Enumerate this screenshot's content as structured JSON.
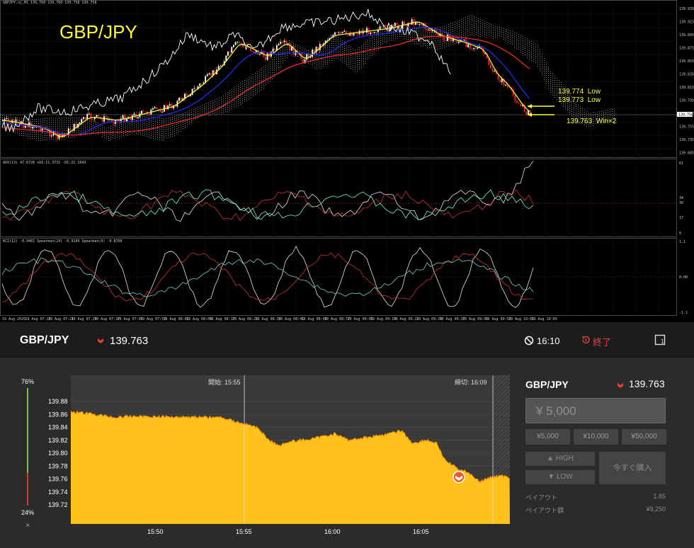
{
  "mt4": {
    "symbol_info": "GBPJPY.oj,M1  139.760 139.760 139.758 139.758",
    "title": "GBP/JPY",
    "annotations": [
      {
        "text": "139.774  Low"
      },
      {
        "text": "139.773  Low"
      },
      {
        "text": "139.763  Win×2"
      }
    ],
    "price_axis": [
      "139.935",
      "139.915",
      "139.895",
      "139.875",
      "139.855",
      "139.835",
      "139.815",
      "139.795",
      "139.775",
      "139.755",
      "139.735",
      "139.685"
    ],
    "current_price": "139.758",
    "adx_label": "ADX(13) 47.6726 +DI:11.3731 -DI:22.1643",
    "adx_axis": [
      "61",
      "34",
      "30",
      "17",
      "0"
    ],
    "rci_label": "RCI(12) -0.9461  Spearman(24) -0.9109  Spearman(9) -0.8708",
    "rci_axis": [
      "1.1",
      "0.00",
      "-1.1"
    ],
    "time_axis": [
      "19 Aug 2020",
      "19 Aug 07:13",
      "19 Aug 07:21",
      "19 Aug 07:29",
      "19 Aug 07:37",
      "19 Aug 07:45",
      "19 Aug 07:53",
      "19 Aug 08:01",
      "19 Aug 08:09",
      "19 Aug 08:17",
      "19 Aug 08:25",
      "19 Aug 08:33",
      "19 Aug 08:41",
      "19 Aug 08:49",
      "19 Aug 08:57",
      "19 Aug 09:05",
      "19 Aug 09:13",
      "19 Aug 09:21",
      "19 Aug 09:29",
      "19 Aug 09:37",
      "19 Aug 09:45",
      "19 Aug 09:53",
      "19 Aug 10:01",
      "19 Aug 10:09"
    ],
    "colors": {
      "bull": "#ffffff",
      "bear": "#ff2020",
      "ma_fast": "#ffff33",
      "ma_mid": "#2030ff",
      "ma_slow": "#ff2a2a",
      "ichimoku": "#d9d9d9"
    }
  },
  "platform": {
    "pair": "GBP/JPY",
    "price": "139.763",
    "direction": "down-arrow-icon",
    "timer": "16:10",
    "end_label": "終了",
    "gauge": {
      "high_pct": "76%",
      "low_pct": "24%",
      "high_fraction": 0.76,
      "close": "×"
    },
    "chart": {
      "start_label": "開始: 15:55",
      "end_label": "締切: 16:09",
      "y_ticks": [
        "139.88",
        "139.86",
        "139.84",
        "139.82",
        "139.80",
        "139.78",
        "139.76",
        "139.74",
        "139.72"
      ],
      "x_ticks": [
        "15:50",
        "15:55",
        "16:00",
        "16:05"
      ],
      "fill_color": "#ffc21c",
      "entry_price": 139.763
    },
    "order": {
      "pair": "GBP/JPY",
      "price": "139.763",
      "amount": "¥ 5,000",
      "quick_amounts": [
        "¥5,000",
        "¥10,000",
        "¥50,000"
      ],
      "high_label": "HIGH",
      "low_label": "LOW",
      "buy_label": "今すぐ購入",
      "payout_label": "ペイアウト",
      "payout_value": "1.85",
      "payout_amount_label": "ペイアウト額",
      "payout_amount_value": "¥9,250"
    }
  }
}
